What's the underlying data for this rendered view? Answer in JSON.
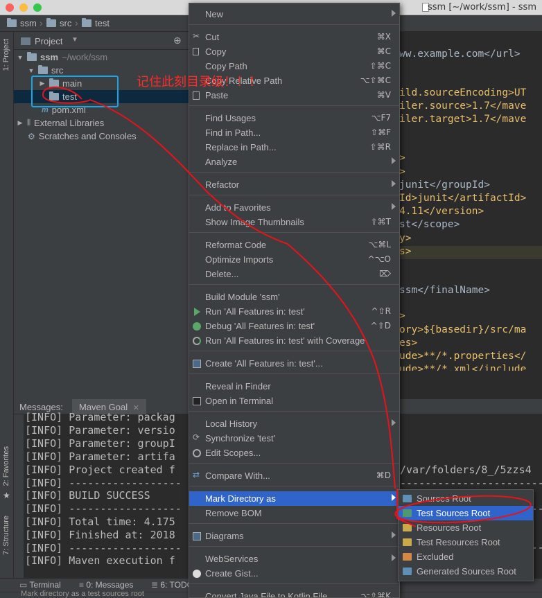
{
  "window": {
    "title": "ssm [~/work/ssm] - ssm"
  },
  "breadcrumb": [
    "ssm",
    "src",
    "test"
  ],
  "left_strip": {
    "project_tab": "1: Project",
    "favorites_tab": "2: Favorites",
    "structure_tab": "7: Structure"
  },
  "project": {
    "header": "Project",
    "tree": [
      {
        "label": "ssm",
        "hint": "~/work/ssm"
      },
      {
        "label": "src"
      },
      {
        "label": "main"
      },
      {
        "label": "test"
      },
      {
        "label": "pom.xml"
      },
      {
        "label": "External Libraries"
      },
      {
        "label": "Scratches and Consoles"
      }
    ]
  },
  "annotation": {
    "note": "记住此刻目录级！！！"
  },
  "editor": {
    "lines": [
      {
        "text": "ww.example.com</url>"
      },
      {
        "text": "ild.sourceEncoding>UT"
      },
      {
        "text": "iler.source>1.7</mave"
      },
      {
        "text": "iler.target>1.7</mave"
      },
      {
        "text": ">"
      },
      {
        "text": ">"
      },
      {
        "text": "junit</groupId>"
      },
      {
        "text": "Id>junit</artifactId>"
      },
      {
        "text": "4.11</version>"
      },
      {
        "text": "st</scope>"
      },
      {
        "text": "y>"
      },
      {
        "text": "s>"
      },
      {
        "text": "ssm</finalName>"
      },
      {
        "text": ">"
      },
      {
        "text": "ory>${basedir}/src/ma"
      },
      {
        "text": "es>"
      },
      {
        "text": "ude>**/*.properties</"
      },
      {
        "text": "ude>**/*.xml</include"
      }
    ]
  },
  "messages": {
    "label": "Messages:",
    "tab": "Maven Goal",
    "log": [
      "[INFO] Parameter: packag",
      "[INFO] Parameter: versio",
      "[INFO] Parameter: groupI",
      "[INFO] Parameter: artifa",
      "[INFO] Project created f",
      "[INFO] ------------------",
      "[INFO] BUILD SUCCESS",
      "[INFO] ------------------",
      "[INFO] Total time: 4.175",
      "[INFO] Finished at: 2018",
      "[INFO] ------------------",
      "[INFO] Maven execution f"
    ],
    "log_right": [
      {
        "text": "/var/folders/8_/5zzs4"
      },
      {
        "text": "-------------------------"
      },
      {
        "text": "-------------------------"
      },
      {
        "text": "-------------------------"
      }
    ]
  },
  "bottom_tabs": [
    "Terminal",
    "0: Messages",
    "6: TODO"
  ],
  "status": {
    "text": "Mark directory as a test sources root"
  },
  "context_menu": {
    "items": [
      {
        "label": "New",
        "submenu": true
      },
      {
        "label": "Cut",
        "shortcut": "⌘X",
        "icon": "scissors-icon"
      },
      {
        "label": "Copy",
        "shortcut": "⌘C",
        "icon": "copy-icon"
      },
      {
        "label": "Copy Path",
        "shortcut": "⇧⌘C"
      },
      {
        "label": "Copy Relative Path",
        "shortcut": "⌥⇧⌘C"
      },
      {
        "label": "Paste",
        "shortcut": "⌘V",
        "icon": "paste-icon"
      },
      {
        "label": "Find Usages",
        "shortcut": "⌥F7"
      },
      {
        "label": "Find in Path...",
        "shortcut": "⇧⌘F"
      },
      {
        "label": "Replace in Path...",
        "shortcut": "⇧⌘R"
      },
      {
        "label": "Analyze",
        "submenu": true
      },
      {
        "label": "Refactor",
        "submenu": true
      },
      {
        "label": "Add to Favorites",
        "submenu": true
      },
      {
        "label": "Show Image Thumbnails",
        "shortcut": "⇧⌘T"
      },
      {
        "label": "Reformat Code",
        "shortcut": "⌥⌘L"
      },
      {
        "label": "Optimize Imports",
        "shortcut": "^⌥O"
      },
      {
        "label": "Delete...",
        "shortcut": "⌦"
      },
      {
        "label": "Build Module 'ssm'"
      },
      {
        "label": "Run 'All Features in: test'",
        "shortcut": "^⇧R",
        "icon": "run-icon"
      },
      {
        "label": "Debug 'All Features in: test'",
        "shortcut": "^⇧D",
        "icon": "debug-icon"
      },
      {
        "label": "Run 'All Features in: test' with Coverage",
        "icon": "coverage-icon"
      },
      {
        "label": "Create 'All Features in: test'...",
        "icon": "create-config-icon"
      },
      {
        "label": "Reveal in Finder"
      },
      {
        "label": "Open in Terminal",
        "icon": "terminal-icon"
      },
      {
        "label": "Local History",
        "submenu": true
      },
      {
        "label": "Synchronize 'test'",
        "icon": "sync-icon"
      },
      {
        "label": "Edit Scopes...",
        "icon": "scope-icon"
      },
      {
        "label": "Compare With...",
        "shortcut": "⌘D",
        "icon": "compare-icon"
      },
      {
        "label": "Mark Directory as",
        "submenu": true,
        "active": true
      },
      {
        "label": "Remove BOM"
      },
      {
        "label": "Diagrams",
        "submenu": true,
        "icon": "diagram-icon"
      },
      {
        "label": "WebServices",
        "submenu": true
      },
      {
        "label": "Create Gist...",
        "icon": "github-icon"
      },
      {
        "label": "Convert Java File to Kotlin File",
        "shortcut": "⌥⇧⌘K"
      }
    ]
  },
  "mark_directory_submenu": {
    "items": [
      {
        "label": "Sources Root",
        "color": "#5f8fb4"
      },
      {
        "label": "Test Sources Root",
        "color": "#4e9a6a",
        "active": true
      },
      {
        "label": "Resources Root",
        "color": "#c9a94a"
      },
      {
        "label": "Test Resources Root",
        "color": "#c9a94a"
      },
      {
        "label": "Excluded",
        "color": "#d08a45"
      },
      {
        "label": "Generated Sources Root",
        "color": "#5f8fb4"
      }
    ]
  },
  "colors": {
    "accent": "#2f65ca",
    "annotation": "#ff2a2a",
    "tag": "#e8bf6a",
    "text": "#a9b7c6"
  }
}
